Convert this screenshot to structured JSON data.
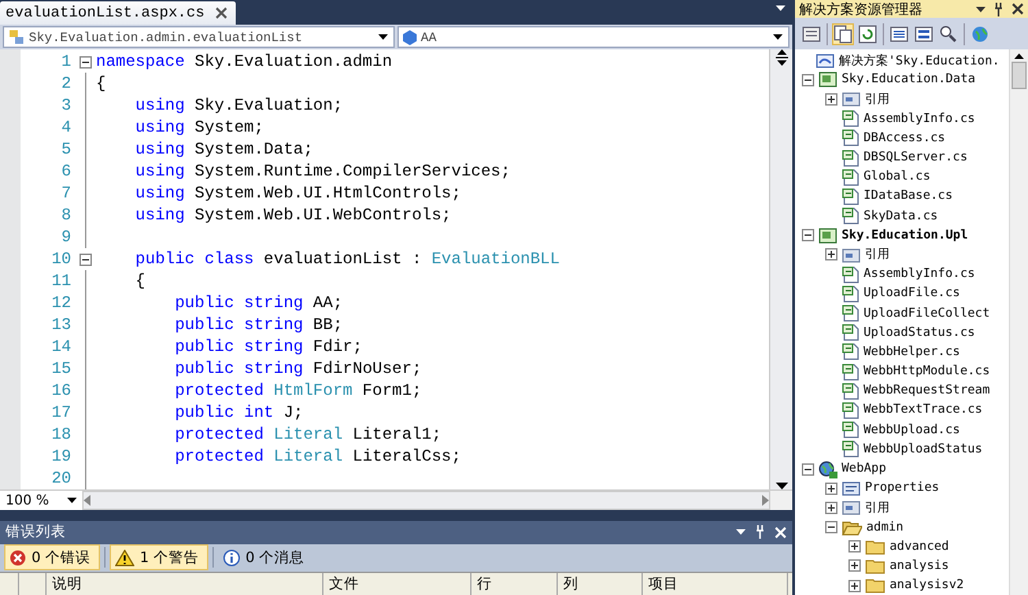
{
  "tab": {
    "label": "evaluationList.aspx.cs",
    "selected": true
  },
  "nav": {
    "type_combo": "Sky.Evaluation.admin.evaluationList",
    "member_combo": "AA"
  },
  "code_lines": [
    {
      "number": "1",
      "foldable": true,
      "segments": [
        {
          "kind": "keyword",
          "text": "namespace"
        },
        {
          "kind": "plain",
          "text": " Sky.Evaluation.admin"
        }
      ]
    },
    {
      "number": "2",
      "segments": [
        {
          "kind": "plain",
          "text": "{"
        }
      ]
    },
    {
      "number": "3",
      "segments": [
        {
          "kind": "keyword",
          "text": "    using"
        },
        {
          "kind": "plain",
          "text": " Sky.Evaluation;"
        }
      ]
    },
    {
      "number": "4",
      "segments": [
        {
          "kind": "keyword",
          "text": "    using"
        },
        {
          "kind": "plain",
          "text": " System;"
        }
      ]
    },
    {
      "number": "5",
      "segments": [
        {
          "kind": "keyword",
          "text": "    using"
        },
        {
          "kind": "plain",
          "text": " System.Data;"
        }
      ]
    },
    {
      "number": "6",
      "segments": [
        {
          "kind": "keyword",
          "text": "    using"
        },
        {
          "kind": "plain",
          "text": " System.Runtime.CompilerServices;"
        }
      ]
    },
    {
      "number": "7",
      "segments": [
        {
          "kind": "keyword",
          "text": "    using"
        },
        {
          "kind": "plain",
          "text": " System.Web.UI.HtmlControls;"
        }
      ]
    },
    {
      "number": "8",
      "segments": [
        {
          "kind": "keyword",
          "text": "    using"
        },
        {
          "kind": "plain",
          "text": " System.Web.UI.WebControls;"
        }
      ]
    },
    {
      "number": "9"
    },
    {
      "number": "10",
      "foldable": true,
      "segments": [
        {
          "kind": "keyword",
          "text": "    public class"
        },
        {
          "kind": "plain",
          "text": " evaluationList : "
        },
        {
          "kind": "type",
          "text": "EvaluationBLL"
        }
      ]
    },
    {
      "number": "11",
      "segments": [
        {
          "kind": "plain",
          "text": "    {"
        }
      ]
    },
    {
      "number": "12",
      "segments": [
        {
          "kind": "keyword",
          "text": "        public string"
        },
        {
          "kind": "plain",
          "text": " AA;"
        }
      ]
    },
    {
      "number": "13",
      "segments": [
        {
          "kind": "keyword",
          "text": "        public string"
        },
        {
          "kind": "plain",
          "text": " BB;"
        }
      ]
    },
    {
      "number": "14",
      "segments": [
        {
          "kind": "keyword",
          "text": "        public string"
        },
        {
          "kind": "plain",
          "text": " Fdir;"
        }
      ]
    },
    {
      "number": "15",
      "segments": [
        {
          "kind": "keyword",
          "text": "        public string"
        },
        {
          "kind": "plain",
          "text": " FdirNoUser;"
        }
      ]
    },
    {
      "number": "16",
      "segments": [
        {
          "kind": "keyword",
          "text": "        protected "
        },
        {
          "kind": "type",
          "text": "HtmlForm"
        },
        {
          "kind": "plain",
          "text": " Form1;"
        }
      ]
    },
    {
      "number": "17",
      "segments": [
        {
          "kind": "keyword",
          "text": "        public int"
        },
        {
          "kind": "plain",
          "text": " J;"
        }
      ]
    },
    {
      "number": "18",
      "segments": [
        {
          "kind": "keyword",
          "text": "        protected "
        },
        {
          "kind": "type",
          "text": "Literal"
        },
        {
          "kind": "plain",
          "text": " Literal1;"
        }
      ]
    },
    {
      "number": "19",
      "segments": [
        {
          "kind": "keyword",
          "text": "        protected "
        },
        {
          "kind": "type",
          "text": "Literal"
        },
        {
          "kind": "plain",
          "text": " LiteralCss;"
        }
      ]
    },
    {
      "number": "20"
    }
  ],
  "zoom": "100 %",
  "error_list": {
    "title": "错误列表",
    "filters": [
      {
        "kind": "error",
        "label": "0 个错误",
        "on": true
      },
      {
        "kind": "warning",
        "label": "1 个警告",
        "on": true
      },
      {
        "kind": "info",
        "label": "0 个消息",
        "on": false
      }
    ],
    "columns": [
      "说明",
      "文件",
      "行",
      "列",
      "项目"
    ]
  },
  "solution_explorer": {
    "title": "解决方案资源管理器",
    "tree": [
      {
        "kind": "solution",
        "label": "解决方案'Sky.Education.",
        "children": [
          {
            "kind": "project",
            "label": "Sky.Education.Data",
            "expanded": true,
            "bold": false,
            "children": [
              {
                "kind": "references",
                "label": "引用",
                "expanded": false
              },
              {
                "kind": "csfile",
                "label": "AssemblyInfo.cs"
              },
              {
                "kind": "csfile",
                "label": "DBAccess.cs"
              },
              {
                "kind": "csfile",
                "label": "DBSQLServer.cs"
              },
              {
                "kind": "csfile",
                "label": "Global.cs"
              },
              {
                "kind": "csfile",
                "label": "IDataBase.cs"
              },
              {
                "kind": "csfile",
                "label": "SkyData.cs"
              }
            ]
          },
          {
            "kind": "project",
            "label": "Sky.Education.Upl",
            "expanded": true,
            "bold": true,
            "children": [
              {
                "kind": "references",
                "label": "引用",
                "expanded": false
              },
              {
                "kind": "csfile",
                "label": "AssemblyInfo.cs"
              },
              {
                "kind": "csfile",
                "label": "UploadFile.cs"
              },
              {
                "kind": "csfile",
                "label": "UploadFileCollect"
              },
              {
                "kind": "csfile",
                "label": "UploadStatus.cs"
              },
              {
                "kind": "csfile",
                "label": "WebbHelper.cs"
              },
              {
                "kind": "csfile",
                "label": "WebbHttpModule.cs"
              },
              {
                "kind": "csfile",
                "label": "WebbRequestStream"
              },
              {
                "kind": "csfile",
                "label": "WebbTextTrace.cs"
              },
              {
                "kind": "csfile",
                "label": "WebbUpload.cs"
              },
              {
                "kind": "csfile",
                "label": "WebbUploadStatus"
              }
            ]
          },
          {
            "kind": "webproject",
            "label": "WebApp",
            "expanded": true,
            "bold": false,
            "children": [
              {
                "kind": "properties",
                "label": "Properties",
                "expanded": false
              },
              {
                "kind": "references",
                "label": "引用",
                "expanded": false
              },
              {
                "kind": "folder",
                "label": "admin",
                "expanded": true,
                "children": [
                  {
                    "kind": "folder",
                    "label": "advanced",
                    "expanded": false
                  },
                  {
                    "kind": "folder",
                    "label": "analysis",
                    "expanded": false
                  },
                  {
                    "kind": "folder",
                    "label": "analysisv2",
                    "expanded": false
                  }
                ]
              }
            ]
          }
        ]
      }
    ]
  }
}
